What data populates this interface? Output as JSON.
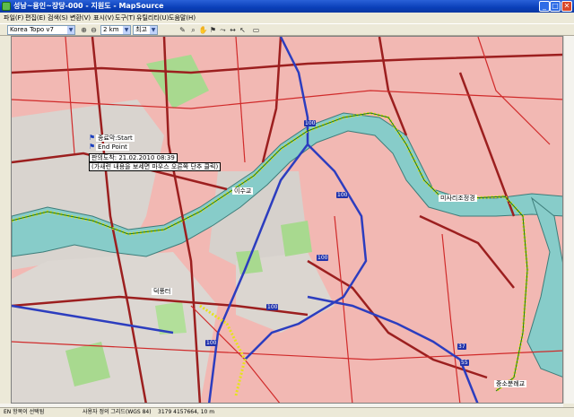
{
  "window": {
    "title": "성남~용인~장당-000 - 지원도 - MapSource",
    "controls": {
      "minimize": "_",
      "maximize": "□",
      "close": "✕"
    }
  },
  "menu": [
    "파일(F)",
    "편집(E)",
    "검색(S)",
    "변환(V)",
    "표시(V)",
    "도구(T)",
    "유틸리티(U)",
    "도움말(H)"
  ],
  "toolbar": {
    "map_product": "Korea Topo v7",
    "zoom_value": "2 km",
    "detail_value": "최고"
  },
  "map": {
    "waypoints": [
      {
        "name": "종료막:Start"
      },
      {
        "name": "End Point"
      }
    ],
    "track_label": "판의도착: 21.02.2010 08:39",
    "track_note": "(가새련 내용을 보세면 마우스 오른쪽 단추 클릭)",
    "road_shields": [
      "100",
      "100",
      "100",
      "100",
      "100",
      "37",
      "55"
    ],
    "place_labels": [
      "미사리조정경",
      "이수교",
      "덕풍터",
      "중소분례교"
    ]
  },
  "status": {
    "left": "EN 항목이 선택됨",
    "grid": "사용자 정의 그리드(WGS 84)",
    "coords": "3179 4157664, 10 m"
  }
}
